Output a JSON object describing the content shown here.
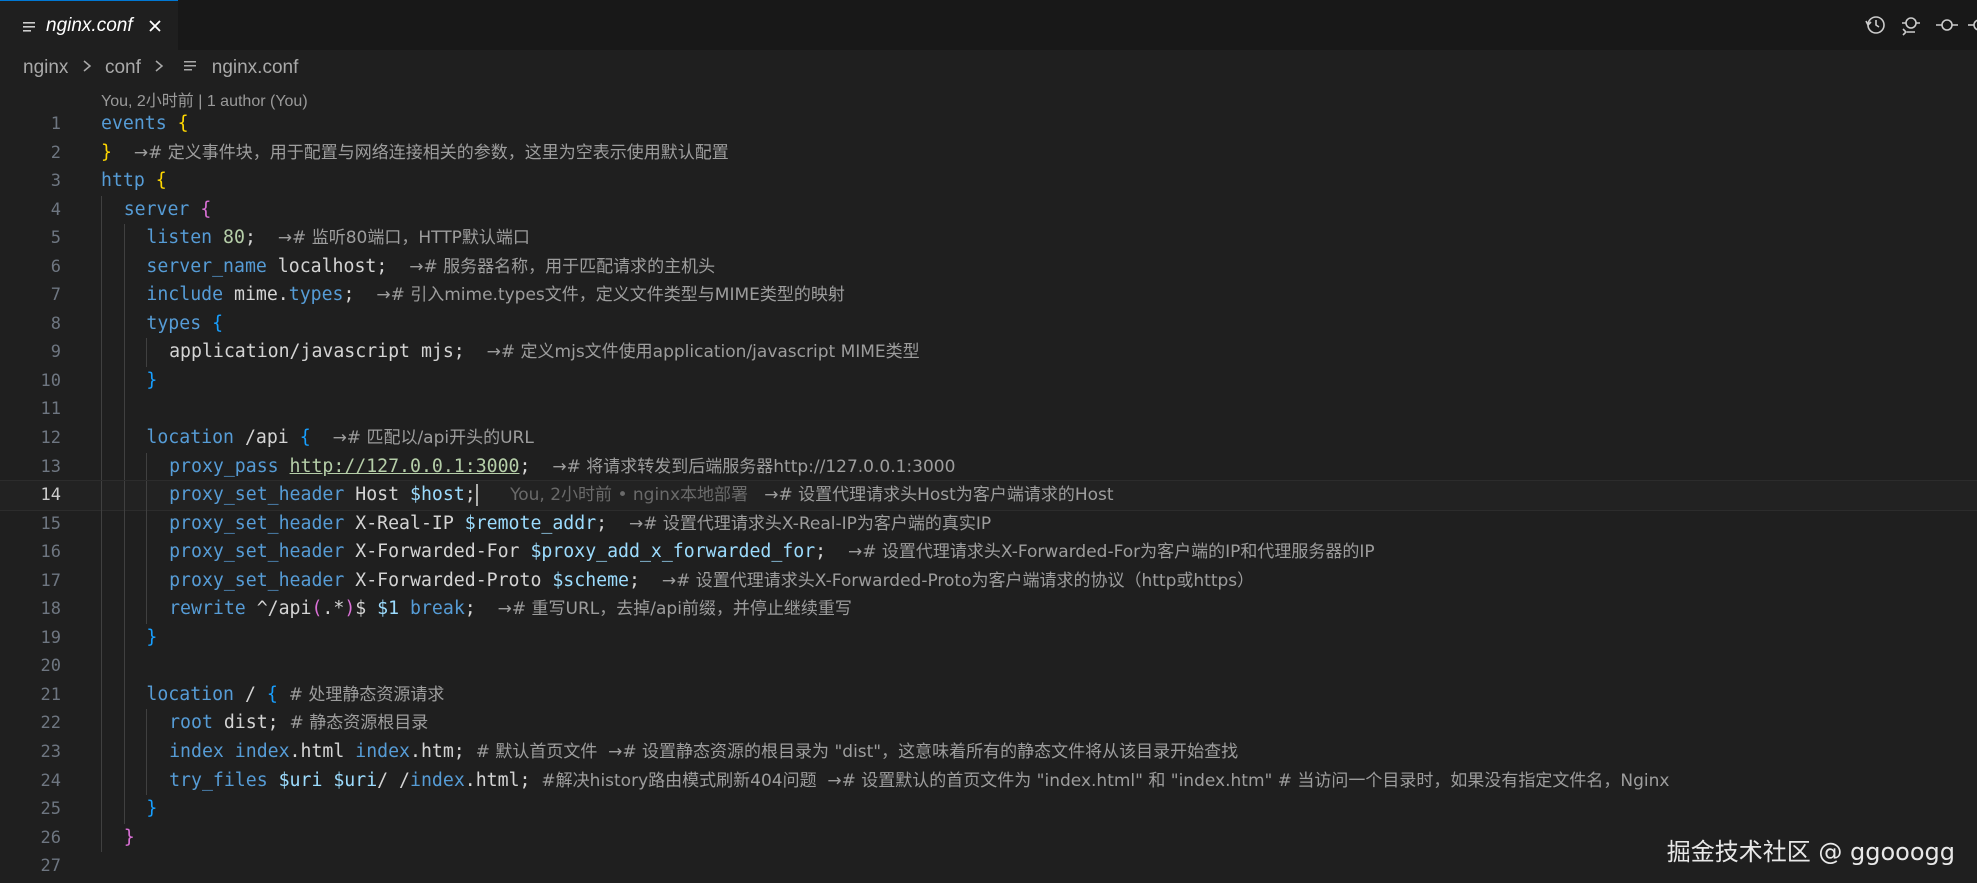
{
  "tab": {
    "label": "nginx.conf",
    "close_icon": "close-icon",
    "file_icon": "file-lines-icon"
  },
  "toolbar": {
    "icons": [
      "history-icon",
      "git-compare-icon",
      "git-commit-icon",
      "git-commit-more-icon"
    ]
  },
  "breadcrumb": {
    "items": [
      "nginx",
      "conf",
      "nginx.conf"
    ]
  },
  "codelens": "You, 2小时前 | 1 author (You)",
  "editor": {
    "current_line": 14,
    "lines": [
      {
        "n": "1",
        "segs": [
          [
            "kw",
            "events "
          ],
          [
            "br1",
            "{"
          ]
        ]
      },
      {
        "n": "2",
        "segs": [
          [
            "br1",
            "}"
          ],
          [
            "tx",
            "  "
          ],
          [
            "cm",
            "→# 定义事件块，用于配置与网络连接相关的参数，这里为空表示使用默认配置"
          ]
        ]
      },
      {
        "n": "3",
        "segs": [
          [
            "kw",
            "http "
          ],
          [
            "br1",
            "{"
          ]
        ]
      },
      {
        "n": "4",
        "indent": 1,
        "segs": [
          [
            "kw",
            "server "
          ],
          [
            "br2",
            "{"
          ]
        ]
      },
      {
        "n": "5",
        "indent": 2,
        "segs": [
          [
            "kw",
            "listen "
          ],
          [
            "num",
            "80"
          ],
          [
            "tx",
            ";  "
          ],
          [
            "cm",
            "→# 监听80端口，HTTP默认端口"
          ]
        ]
      },
      {
        "n": "6",
        "indent": 2,
        "segs": [
          [
            "kw",
            "server_name "
          ],
          [
            "tx",
            "localhost;  "
          ],
          [
            "cm",
            "→# 服务器名称，用于匹配请求的主机头"
          ]
        ]
      },
      {
        "n": "7",
        "indent": 2,
        "segs": [
          [
            "kw",
            "include "
          ],
          [
            "tx",
            "mime."
          ],
          [
            "kw",
            "types"
          ],
          [
            "tx",
            ";  "
          ],
          [
            "cm",
            "→# 引入mime.types文件，定义文件类型与MIME类型的映射"
          ]
        ]
      },
      {
        "n": "8",
        "indent": 2,
        "segs": [
          [
            "kw",
            "types "
          ],
          [
            "br3",
            "{"
          ]
        ]
      },
      {
        "n": "9",
        "indent": 3,
        "segs": [
          [
            "tx",
            "application/javascript mjs;  "
          ],
          [
            "cm",
            "→# 定义mjs文件使用application/javascript MIME类型"
          ]
        ]
      },
      {
        "n": "10",
        "indent": 2,
        "segs": [
          [
            "br3",
            "}"
          ]
        ]
      },
      {
        "n": "11",
        "indent": 2,
        "segs": []
      },
      {
        "n": "12",
        "indent": 2,
        "segs": [
          [
            "kw",
            "location "
          ],
          [
            "tx",
            "/api "
          ],
          [
            "br3",
            "{"
          ],
          [
            "tx",
            "  "
          ],
          [
            "cm",
            "→# 匹配以/api开头的URL"
          ]
        ]
      },
      {
        "n": "13",
        "indent": 3,
        "segs": [
          [
            "kw",
            "proxy_pass "
          ],
          [
            "url",
            "http://127.0.0.1:3000"
          ],
          [
            "tx",
            ";  "
          ],
          [
            "cm",
            "→# 将请求转发到后端服务器http://127.0.0.1:3000"
          ]
        ]
      },
      {
        "n": "14",
        "indent": 3,
        "segs": [
          [
            "kw",
            "proxy_set_header "
          ],
          [
            "tx",
            "Host "
          ],
          [
            "var",
            "$host"
          ],
          [
            "tx",
            ";"
          ],
          [
            "cursor",
            ""
          ],
          [
            "blame",
            "      You, 2小时前 • nginx本地部署   "
          ],
          [
            "cm",
            "→# 设置代理请求头Host为客户端请求的Host"
          ]
        ]
      },
      {
        "n": "15",
        "indent": 3,
        "segs": [
          [
            "kw",
            "proxy_set_header "
          ],
          [
            "tx",
            "X-Real-IP "
          ],
          [
            "var",
            "$remote_addr"
          ],
          [
            "tx",
            ";  "
          ],
          [
            "cm",
            "→# 设置代理请求头X-Real-IP为客户端的真实IP"
          ]
        ]
      },
      {
        "n": "16",
        "indent": 3,
        "segs": [
          [
            "kw",
            "proxy_set_header "
          ],
          [
            "tx",
            "X-Forwarded-For "
          ],
          [
            "var",
            "$proxy_add_x_forwarded_for"
          ],
          [
            "tx",
            ";  "
          ],
          [
            "cm",
            "→# 设置代理请求头X-Forwarded-For为客户端的IP和代理服务器的IP"
          ]
        ]
      },
      {
        "n": "17",
        "indent": 3,
        "segs": [
          [
            "kw",
            "proxy_set_header "
          ],
          [
            "tx",
            "X-Forwarded-Proto "
          ],
          [
            "var",
            "$scheme"
          ],
          [
            "tx",
            ";  "
          ],
          [
            "cm",
            "→# 设置代理请求头X-Forwarded-Proto为客户端请求的协议（http或https）"
          ]
        ]
      },
      {
        "n": "18",
        "indent": 3,
        "segs": [
          [
            "kw",
            "rewrite "
          ],
          [
            "tx",
            "^/api"
          ],
          [
            "br2",
            "("
          ],
          [
            "tx",
            ".*"
          ],
          [
            "br2",
            ")"
          ],
          [
            "tx",
            "$ "
          ],
          [
            "var",
            "$1"
          ],
          [
            "kw",
            " break"
          ],
          [
            "tx",
            ";  "
          ],
          [
            "cm",
            "→# 重写URL，去掉/api前缀，并停止继续重写"
          ]
        ]
      },
      {
        "n": "19",
        "indent": 2,
        "segs": [
          [
            "br3",
            "}"
          ]
        ]
      },
      {
        "n": "20",
        "indent": 2,
        "segs": []
      },
      {
        "n": "21",
        "indent": 2,
        "segs": [
          [
            "kw",
            "location "
          ],
          [
            "tx",
            "/ "
          ],
          [
            "br3",
            "{"
          ],
          [
            "tx",
            " "
          ],
          [
            "cm",
            "# 处理静态资源请求"
          ]
        ]
      },
      {
        "n": "22",
        "indent": 3,
        "segs": [
          [
            "kw",
            "root "
          ],
          [
            "tx",
            "dist; "
          ],
          [
            "cm",
            "# 静态资源根目录"
          ]
        ]
      },
      {
        "n": "23",
        "indent": 3,
        "segs": [
          [
            "kw",
            "index "
          ],
          [
            "kw",
            "index"
          ],
          [
            "tx",
            ".html "
          ],
          [
            "kw",
            "index"
          ],
          [
            "tx",
            ".htm; "
          ],
          [
            "cm",
            "# 默认首页文件  →# 设置静态资源的根目录为 \"dist\"，这意味着所有的静态文件将从该目录开始查找"
          ]
        ]
      },
      {
        "n": "24",
        "indent": 3,
        "segs": [
          [
            "kw",
            "try_files "
          ],
          [
            "var",
            "$uri $uri"
          ],
          [
            "tx",
            "/ /"
          ],
          [
            "kw",
            "index"
          ],
          [
            "tx",
            ".html; "
          ],
          [
            "cm",
            "#解决history路由模式刷新404问题  →# 设置默认的首页文件为 \"index.html\" 和 \"index.htm\" # 当访问一个目录时，如果没有指定文件名，Nginx"
          ]
        ]
      },
      {
        "n": "25",
        "indent": 2,
        "segs": [
          [
            "br3",
            "}"
          ]
        ]
      },
      {
        "n": "26",
        "indent": 1,
        "segs": [
          [
            "br2",
            "}"
          ]
        ]
      },
      {
        "n": "27",
        "indent": 0,
        "segs": []
      }
    ]
  },
  "watermark": "掘金技术社区 @ ggooogg",
  "colors": {
    "background": "#1f1f1f",
    "keyword": "#569cd6",
    "comment": "#9d9d9d",
    "variable": "#9cdcfe",
    "number": "#b5cea8"
  }
}
